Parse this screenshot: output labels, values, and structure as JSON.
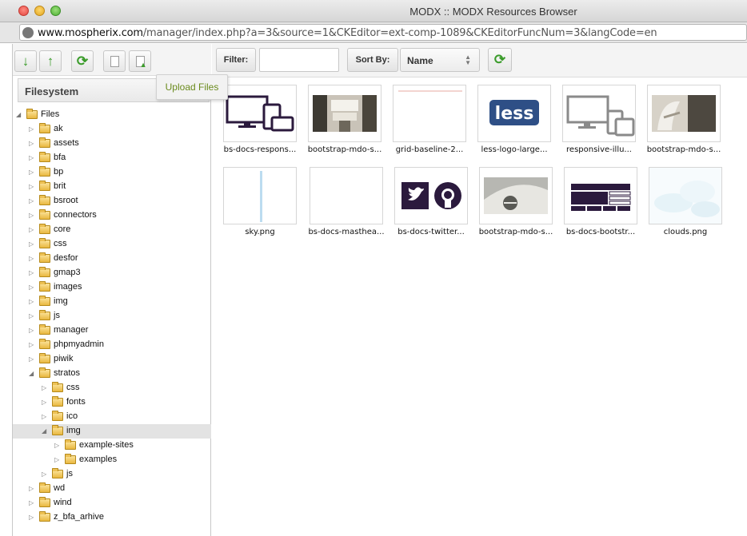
{
  "window": {
    "title": "MODX :: MODX Resources Browser",
    "url_host": "www.mospherix.com",
    "url_path": "/manager/index.php?a=3&source=1&CKEditor=ext-comp-1089&CKEditorFuncNum=3&langCode=en"
  },
  "left_panel": {
    "toolbar": {
      "buttons": [
        "arrow-down-icon",
        "arrow-up-icon",
        "refresh-icon",
        "new-file-icon",
        "upload-files-icon"
      ]
    },
    "tooltip": "Upload Files",
    "header": "Filesystem",
    "tree": [
      {
        "label": "Files",
        "level": 0,
        "expanded": true
      },
      {
        "label": "ak",
        "level": 1,
        "expanded": false
      },
      {
        "label": "assets",
        "level": 1,
        "expanded": false
      },
      {
        "label": "bfa",
        "level": 1,
        "expanded": false
      },
      {
        "label": "bp",
        "level": 1,
        "expanded": false
      },
      {
        "label": "brit",
        "level": 1,
        "expanded": false
      },
      {
        "label": "bsroot",
        "level": 1,
        "expanded": false
      },
      {
        "label": "connectors",
        "level": 1,
        "expanded": false
      },
      {
        "label": "core",
        "level": 1,
        "expanded": false
      },
      {
        "label": "css",
        "level": 1,
        "expanded": false
      },
      {
        "label": "desfor",
        "level": 1,
        "expanded": false
      },
      {
        "label": "gmap3",
        "level": 1,
        "expanded": false
      },
      {
        "label": "images",
        "level": 1,
        "expanded": false
      },
      {
        "label": "img",
        "level": 1,
        "expanded": false
      },
      {
        "label": "js",
        "level": 1,
        "expanded": false
      },
      {
        "label": "manager",
        "level": 1,
        "expanded": false
      },
      {
        "label": "phpmyadmin",
        "level": 1,
        "expanded": false
      },
      {
        "label": "piwik",
        "level": 1,
        "expanded": false
      },
      {
        "label": "stratos",
        "level": 1,
        "expanded": true
      },
      {
        "label": "css",
        "level": 2,
        "expanded": false
      },
      {
        "label": "fonts",
        "level": 2,
        "expanded": false
      },
      {
        "label": "ico",
        "level": 2,
        "expanded": false
      },
      {
        "label": "img",
        "level": 2,
        "expanded": true,
        "selected": true
      },
      {
        "label": "example-sites",
        "level": 3,
        "expanded": false
      },
      {
        "label": "examples",
        "level": 3,
        "expanded": false
      },
      {
        "label": "js",
        "level": 2,
        "expanded": false
      },
      {
        "label": "wd",
        "level": 1,
        "expanded": false
      },
      {
        "label": "wind",
        "level": 1,
        "expanded": false
      },
      {
        "label": "z_bfa_arhive",
        "level": 1,
        "expanded": false
      }
    ]
  },
  "right_panel": {
    "filter_label": "Filter:",
    "filter_value": "",
    "sort_label": "Sort By:",
    "sort_value": "Name",
    "files": [
      {
        "name": "bs-docs-respons...",
        "thumb": "devices-dark"
      },
      {
        "name": "bootstrap-mdo-s...",
        "thumb": "photo-building"
      },
      {
        "name": "grid-baseline-2...",
        "thumb": "grid-lines"
      },
      {
        "name": "less-logo-large...",
        "thumb": "less-logo"
      },
      {
        "name": "responsive-illu...",
        "thumb": "devices-gray"
      },
      {
        "name": "bootstrap-mdo-s...",
        "thumb": "photo-sculpture"
      },
      {
        "name": "sky.png",
        "thumb": "sky-strip"
      },
      {
        "name": "bs-docs-masthea...",
        "thumb": "blank"
      },
      {
        "name": "bs-docs-twitter...",
        "thumb": "twitter-github"
      },
      {
        "name": "bootstrap-mdo-s...",
        "thumb": "photo-ceiling"
      },
      {
        "name": "bs-docs-bootstr...",
        "thumb": "bootstrap-layout"
      },
      {
        "name": "clouds.png",
        "thumb": "clouds"
      }
    ]
  },
  "colors": {
    "accent_green": "#3b9c2b",
    "tooltip_text": "#6a8a1c",
    "bootstrap_purple": "#2b1a3d"
  }
}
